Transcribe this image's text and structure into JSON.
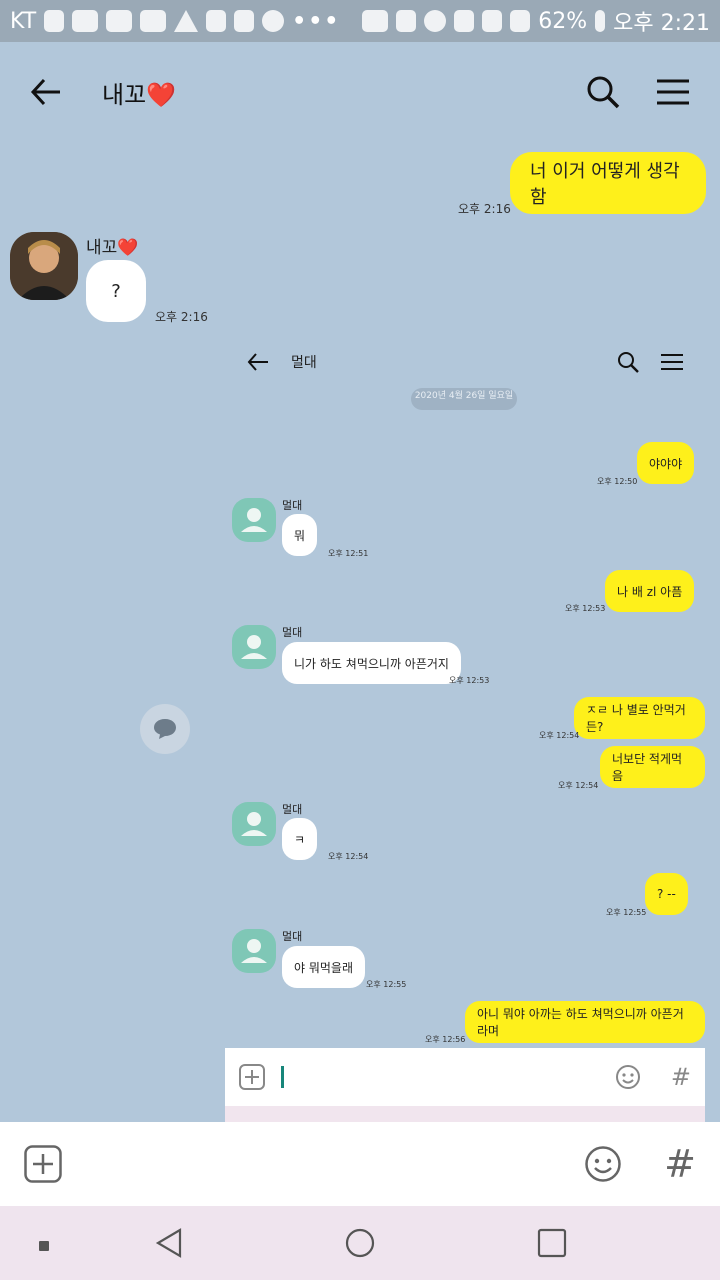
{
  "status": {
    "carrier": "KT",
    "battery": "62%",
    "time": "오후 2:21"
  },
  "header": {
    "title": "내꼬",
    "heart": "❤️"
  },
  "messages": {
    "sent1": {
      "text": "너 이거 어떻게 생각함",
      "time": "오후 2:16"
    },
    "recv1": {
      "sender": "내꼬",
      "heart": "❤️",
      "text": "?",
      "time": "오후 2:16"
    }
  },
  "screenshot": {
    "title": "멀대",
    "date": "2020년 4월 26일 일요일",
    "msgs": [
      {
        "text": "야야야",
        "time": "오후 12:50"
      },
      {
        "sender": "멀대",
        "text": "뭐",
        "time": "오후 12:51"
      },
      {
        "text": "나 배 zl 아픔",
        "time": "오후 12:53"
      },
      {
        "sender": "멀대",
        "text": "니가 하도 쳐먹으니까 아픈거지",
        "time": "오후 12:53"
      },
      {
        "text": "ㅈㄹ 나 별로 안먹거든?",
        "time": "오후 12:54"
      },
      {
        "text": "너보단 적게먹음",
        "time": "오후 12:54"
      },
      {
        "sender": "멀대",
        "text": "ㅋ",
        "time": "오후 12:54"
      },
      {
        "text": "? --",
        "time": "오후 12:55"
      },
      {
        "sender": "멀대",
        "text": "야 뭐먹을래",
        "time": "오후 12:55"
      },
      {
        "text": "아니 뭐야 아까는 하도 쳐먹으니까 아픈거라며",
        "time": "오후 12:56"
      }
    ]
  },
  "input": {
    "hash": "#"
  },
  "colors": {
    "background": "#b2c7da",
    "yellow": "#fef01b",
    "avatar_green": "#7fc7b6"
  }
}
